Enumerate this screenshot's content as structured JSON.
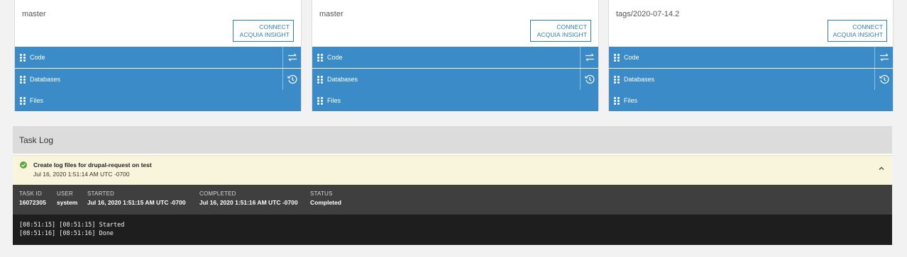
{
  "environments": [
    {
      "branch": "master",
      "insight_button": [
        "CONNECT",
        "ACQUIA INSIGHT"
      ],
      "rows": [
        {
          "label": "Code",
          "action_icon": "swap-arrows-icon"
        },
        {
          "label": "Databases",
          "action_icon": "history-icon"
        },
        {
          "label": "Files",
          "action_icon": null
        }
      ]
    },
    {
      "branch": "master",
      "insight_button": [
        "CONNECT",
        "ACQUIA INSIGHT"
      ],
      "rows": [
        {
          "label": "Code",
          "action_icon": "swap-arrows-icon"
        },
        {
          "label": "Databases",
          "action_icon": "history-icon"
        },
        {
          "label": "Files",
          "action_icon": null
        }
      ]
    },
    {
      "branch": "tags/2020-07-14.2",
      "insight_button": [
        "CONNECT",
        "ACQUIA INSIGHT"
      ],
      "rows": [
        {
          "label": "Code",
          "action_icon": "swap-arrows-icon"
        },
        {
          "label": "Databases",
          "action_icon": "history-icon"
        },
        {
          "label": "Files",
          "action_icon": null
        }
      ]
    }
  ],
  "task_log": {
    "heading": "Task Log",
    "task": {
      "title": "Create log files for drupal-request on test",
      "date": "Jul 16, 2020 1:51:14 AM UTC -0700",
      "status_icon": "check-circle-icon",
      "meta": {
        "task_id_label": "TASK ID",
        "task_id": "16072305",
        "user_label": "USER",
        "user": "system",
        "started_label": "STARTED",
        "started": "Jul 16, 2020 1:51:15 AM UTC -0700",
        "completed_label": "COMPLETED",
        "completed": "Jul 16, 2020 1:51:16 AM UTC -0700",
        "status_label": "STATUS",
        "status": "Completed"
      },
      "console": [
        "[08:51:15] [08:51:15] Started",
        "[08:51:16] [08:51:16] Done"
      ]
    }
  },
  "colors": {
    "accent": "#3a8bc7",
    "success": "#58a83a",
    "task_bg": "#f8f5dc",
    "meta_bg": "#3f3f3f",
    "console_bg": "#1e1e1e"
  }
}
